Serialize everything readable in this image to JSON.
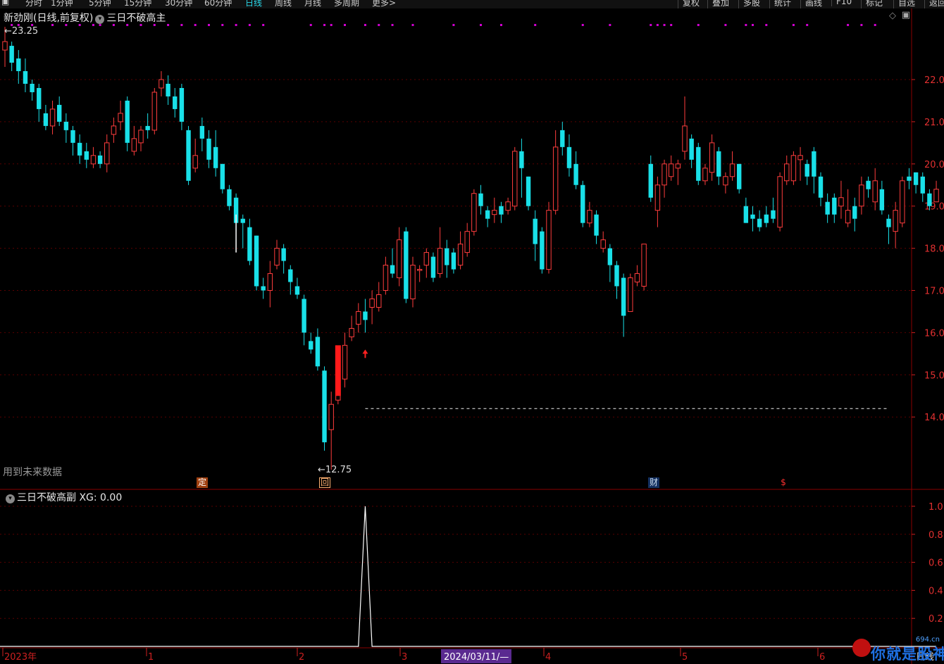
{
  "toolbar": {
    "items": [
      "分时",
      "1分钟",
      "5分钟",
      "15分钟",
      "30分钟",
      "60分钟",
      "日线",
      "周线",
      "月线",
      "多周期",
      "更多>"
    ],
    "active": "日线",
    "right_buttons": [
      "复权",
      "叠加",
      "多股",
      "统计",
      "画线",
      "F10",
      "标记",
      "自选",
      "返回"
    ]
  },
  "main": {
    "title": "新劲刚(日线,前复权)",
    "indicator_name": "三日不破高主",
    "high_label": "←23.25",
    "low_label": "←12.75",
    "future_note": "用到未来数据",
    "markers": {
      "ding": "定",
      "hui": "回",
      "cai": "财",
      "dollar": "$"
    },
    "y_ticks": [
      "22.0",
      "21.0",
      "20.0",
      "19.0",
      "18.0",
      "17.0",
      "16.0",
      "15.0",
      "14.0"
    ],
    "line_level": "14.2"
  },
  "indicator": {
    "title": "三日不破高副",
    "value_label": "XG: 0.00",
    "y_ticks": [
      "1.0",
      "0.8",
      "0.6",
      "0.4",
      "0.2"
    ]
  },
  "xaxis": {
    "labels": [
      "2023年",
      "1",
      "2",
      "3",
      "2024/03/11/—",
      "4",
      "5",
      "6"
    ],
    "period": "日线"
  },
  "watermark": {
    "text": "你就是股神",
    "site": "694.cn"
  },
  "colors": {
    "up": "#ff3d3d",
    "down": "#19e0e8",
    "grid": "#5a0000",
    "dot": "#d000d0"
  },
  "chart_data": {
    "type": "candlestick",
    "ylim": [
      12.4,
      23.6
    ],
    "candles": [
      [
        22.7,
        22.9,
        23.25,
        22.3
      ],
      [
        22.8,
        22.4,
        22.9,
        22.2
      ],
      [
        22.5,
        22.2,
        22.7,
        21.9
      ],
      [
        22.2,
        21.9,
        22.5,
        21.7
      ],
      [
        21.9,
        21.7,
        22.0,
        21.5
      ],
      [
        21.8,
        21.3,
        21.9,
        21.0
      ],
      [
        21.2,
        20.9,
        21.4,
        20.8
      ],
      [
        20.9,
        21.3,
        21.5,
        20.7
      ],
      [
        21.4,
        21.0,
        21.6,
        20.9
      ],
      [
        21.0,
        20.8,
        21.2,
        20.5
      ],
      [
        20.8,
        20.5,
        20.9,
        20.2
      ],
      [
        20.5,
        20.2,
        20.7,
        20.0
      ],
      [
        20.3,
        20.1,
        20.5,
        19.9
      ],
      [
        20.0,
        20.2,
        20.4,
        19.9
      ],
      [
        20.2,
        20.0,
        20.3,
        19.9
      ],
      [
        20.0,
        20.5,
        20.7,
        19.8
      ],
      [
        20.7,
        20.9,
        21.1,
        20.5
      ],
      [
        21.0,
        21.2,
        21.5,
        20.8
      ],
      [
        21.5,
        20.5,
        21.6,
        20.3
      ],
      [
        20.3,
        20.6,
        20.9,
        20.2
      ],
      [
        20.5,
        20.8,
        20.9,
        20.3
      ],
      [
        20.9,
        20.8,
        21.2,
        20.6
      ],
      [
        20.8,
        21.7,
        21.8,
        20.7
      ],
      [
        21.8,
        22.0,
        22.2,
        21.6
      ],
      [
        21.9,
        21.6,
        22.1,
        21.4
      ],
      [
        21.6,
        21.3,
        21.8,
        21.1
      ],
      [
        21.8,
        21.0,
        21.9,
        20.8
      ],
      [
        20.8,
        19.6,
        20.9,
        19.5
      ],
      [
        19.9,
        20.2,
        20.6,
        19.8
      ],
      [
        20.9,
        20.6,
        21.1,
        20.3
      ],
      [
        20.6,
        20.1,
        20.8,
        19.9
      ],
      [
        20.4,
        19.9,
        20.8,
        19.7
      ],
      [
        20.0,
        19.4,
        20.0,
        19.3
      ],
      [
        19.4,
        19.0,
        19.5,
        18.9
      ],
      [
        19.2,
        18.6,
        19.3,
        18.4
      ],
      [
        18.7,
        18.6,
        18.8,
        18.0
      ],
      [
        18.5,
        17.7,
        18.7,
        17.6
      ],
      [
        18.3,
        17.1,
        18.3,
        17.0
      ],
      [
        17.1,
        17.0,
        17.3,
        16.8
      ],
      [
        17.0,
        17.4,
        17.7,
        16.6
      ],
      [
        17.6,
        18.0,
        18.2,
        17.5
      ],
      [
        18.0,
        17.7,
        18.1,
        17.4
      ],
      [
        17.5,
        17.2,
        17.6,
        16.9
      ],
      [
        17.1,
        16.9,
        17.3,
        16.8
      ],
      [
        16.8,
        16.0,
        16.9,
        15.7
      ],
      [
        15.8,
        15.6,
        16.0,
        15.5
      ],
      [
        15.9,
        15.2,
        16.1,
        15.1
      ],
      [
        15.1,
        13.4,
        15.2,
        13.2
      ],
      [
        13.7,
        14.3,
        14.6,
        12.75
      ],
      [
        14.4,
        14.7,
        15.0,
        14.3
      ],
      [
        14.9,
        15.7,
        16.0,
        14.7
      ],
      [
        15.9,
        16.1,
        16.4,
        15.8
      ],
      [
        16.2,
        16.5,
        16.7,
        16.0
      ],
      [
        16.5,
        16.3,
        16.8,
        16.0
      ],
      [
        16.6,
        16.8,
        17.0,
        16.2
      ],
      [
        16.6,
        16.9,
        17.2,
        16.5
      ],
      [
        17.0,
        17.6,
        17.8,
        16.9
      ],
      [
        17.6,
        17.4,
        18.0,
        17.3
      ],
      [
        17.3,
        18.2,
        18.5,
        17.1
      ],
      [
        18.4,
        16.8,
        18.5,
        16.7
      ],
      [
        16.8,
        17.6,
        17.8,
        16.6
      ],
      [
        17.5,
        17.5,
        17.6,
        17.2
      ],
      [
        17.6,
        17.9,
        18.0,
        17.3
      ],
      [
        17.8,
        17.3,
        17.9,
        17.2
      ],
      [
        17.4,
        18.0,
        18.5,
        17.3
      ],
      [
        18.0,
        17.6,
        18.2,
        17.3
      ],
      [
        17.9,
        17.5,
        18.0,
        17.4
      ],
      [
        17.6,
        18.1,
        18.4,
        17.5
      ],
      [
        17.9,
        18.4,
        18.6,
        17.8
      ],
      [
        18.4,
        19.3,
        19.4,
        18.3
      ],
      [
        19.3,
        19.0,
        19.5,
        18.8
      ],
      [
        18.9,
        18.7,
        19.0,
        18.5
      ],
      [
        18.8,
        18.9,
        19.2,
        18.6
      ],
      [
        19.0,
        18.8,
        19.1,
        18.6
      ],
      [
        18.9,
        19.1,
        19.2,
        18.8
      ],
      [
        19.0,
        20.3,
        20.4,
        18.9
      ],
      [
        20.3,
        19.9,
        20.6,
        19.2
      ],
      [
        19.7,
        19.0,
        19.7,
        18.9
      ],
      [
        18.7,
        18.1,
        18.9,
        17.7
      ],
      [
        18.4,
        17.5,
        18.5,
        17.4
      ],
      [
        17.5,
        18.9,
        19.1,
        17.4
      ],
      [
        18.9,
        20.4,
        20.8,
        18.8
      ],
      [
        20.8,
        20.4,
        21.0,
        20.2
      ],
      [
        20.4,
        19.9,
        20.7,
        19.7
      ],
      [
        20.0,
        19.5,
        20.3,
        19.4
      ],
      [
        19.5,
        18.6,
        19.6,
        18.5
      ],
      [
        18.6,
        18.9,
        19.1,
        18.5
      ],
      [
        18.8,
        18.3,
        18.9,
        18.1
      ],
      [
        18.0,
        18.2,
        18.4,
        17.9
      ],
      [
        18.0,
        17.6,
        18.1,
        17.2
      ],
      [
        17.6,
        17.1,
        17.7,
        16.8
      ],
      [
        17.3,
        16.4,
        17.4,
        15.9
      ],
      [
        16.5,
        17.3,
        17.4,
        16.5
      ],
      [
        17.2,
        17.4,
        17.6,
        17.1
      ],
      [
        17.1,
        18.1,
        18.1,
        17.0
      ],
      [
        20.0,
        19.2,
        20.2,
        19.1
      ],
      [
        18.9,
        19.5,
        19.7,
        18.5
      ],
      [
        19.5,
        20.0,
        20.1,
        19.2
      ],
      [
        19.7,
        20.0,
        20.2,
        19.6
      ],
      [
        19.9,
        20.0,
        20.1,
        19.5
      ],
      [
        20.3,
        20.9,
        21.6,
        20.1
      ],
      [
        20.6,
        20.1,
        20.7,
        19.9
      ],
      [
        20.4,
        19.6,
        20.5,
        19.5
      ],
      [
        19.6,
        19.9,
        20.0,
        19.5
      ],
      [
        19.8,
        20.5,
        20.7,
        19.6
      ],
      [
        20.3,
        19.7,
        20.4,
        19.5
      ],
      [
        19.5,
        19.7,
        19.8,
        19.3
      ],
      [
        19.7,
        20.0,
        20.3,
        19.6
      ],
      [
        20.0,
        19.4,
        20.0,
        19.3
      ],
      [
        19.0,
        18.6,
        19.2,
        18.6
      ],
      [
        18.8,
        18.7,
        19.0,
        18.4
      ],
      [
        18.7,
        18.5,
        18.9,
        18.4
      ],
      [
        18.8,
        18.6,
        19.0,
        18.5
      ],
      [
        18.9,
        18.7,
        19.2,
        18.6
      ],
      [
        18.5,
        19.7,
        19.8,
        18.4
      ],
      [
        19.6,
        20.0,
        20.2,
        19.5
      ],
      [
        19.6,
        20.2,
        20.3,
        19.5
      ],
      [
        20.1,
        20.2,
        20.4,
        19.6
      ],
      [
        20.0,
        19.7,
        20.1,
        19.5
      ],
      [
        20.3,
        19.7,
        20.4,
        19.3
      ],
      [
        19.7,
        19.2,
        19.8,
        19.0
      ],
      [
        19.1,
        18.8,
        19.3,
        18.6
      ],
      [
        19.2,
        18.8,
        19.3,
        18.6
      ],
      [
        19.0,
        19.2,
        19.6,
        18.7
      ],
      [
        18.6,
        18.9,
        19.4,
        18.5
      ],
      [
        19.0,
        18.7,
        19.2,
        18.4
      ],
      [
        19.0,
        19.5,
        19.7,
        18.8
      ],
      [
        19.6,
        19.4,
        19.7,
        19.2
      ],
      [
        19.1,
        19.6,
        19.9,
        18.9
      ],
      [
        19.4,
        18.9,
        19.6,
        18.8
      ],
      [
        18.7,
        18.5,
        18.8,
        18.1
      ],
      [
        18.4,
        18.9,
        19.1,
        18.0
      ],
      [
        18.6,
        19.6,
        19.7,
        18.5
      ],
      [
        19.7,
        19.6,
        19.9,
        19.4
      ],
      [
        19.8,
        19.5,
        19.8,
        19.3
      ],
      [
        19.7,
        19.3,
        19.8,
        19.1
      ],
      [
        19.3,
        19.0,
        19.4,
        18.9
      ],
      [
        19.1,
        19.4,
        19.6,
        19.1
      ]
    ],
    "indicator_xg": {
      "index": 53,
      "value": 1.0
    },
    "note": "candles = [open, close, high, low]"
  }
}
